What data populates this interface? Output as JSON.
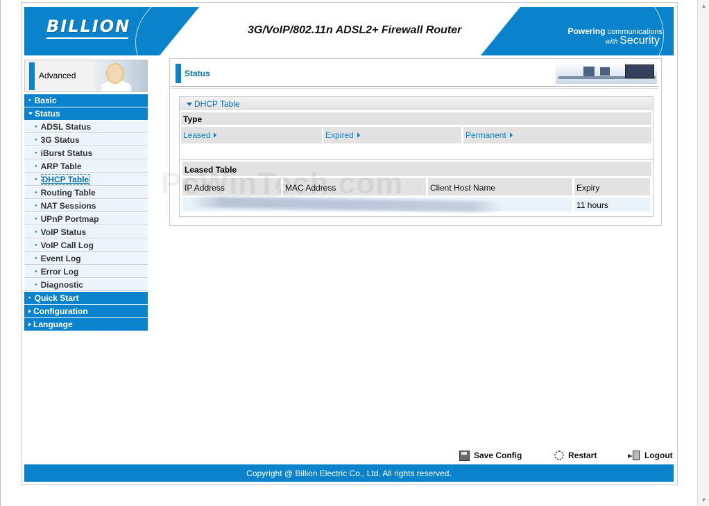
{
  "header": {
    "logo": "BILLION",
    "router_title": "3G/VoIP/802.11n ADSL2+ Firewall Router",
    "tagline_powering": "Powering",
    "tagline_communications": "communications",
    "tagline_with": "with",
    "tagline_security": "Security"
  },
  "sidebar": {
    "mode_label": "Advanced",
    "items": [
      {
        "label": "Basic",
        "type": "main",
        "expanded": false
      },
      {
        "label": "Status",
        "type": "main",
        "expanded": true
      },
      {
        "label": "ADSL Status",
        "type": "sub"
      },
      {
        "label": "3G Status",
        "type": "sub"
      },
      {
        "label": "iBurst Status",
        "type": "sub"
      },
      {
        "label": "ARP Table",
        "type": "sub"
      },
      {
        "label": "DHCP Table",
        "type": "sub",
        "active": true
      },
      {
        "label": "Routing Table",
        "type": "sub"
      },
      {
        "label": "NAT Sessions",
        "type": "sub"
      },
      {
        "label": "UPnP Portmap",
        "type": "sub"
      },
      {
        "label": "VoIP Status",
        "type": "sub"
      },
      {
        "label": "VoIP Call Log",
        "type": "sub"
      },
      {
        "label": "Event Log",
        "type": "sub"
      },
      {
        "label": "Error Log",
        "type": "sub"
      },
      {
        "label": "Diagnostic",
        "type": "sub"
      },
      {
        "label": "Quick Start",
        "type": "main",
        "expanded": false
      },
      {
        "label": "Configuration",
        "type": "main",
        "expanded": false
      },
      {
        "label": "Language",
        "type": "main",
        "expanded": false
      }
    ]
  },
  "content": {
    "section_title": "Status",
    "dhcp": {
      "title": "DHCP Table",
      "type_label": "Type",
      "type_links": [
        "Leased",
        "Expired",
        "Permanent"
      ],
      "leased_table_title": "Leased Table",
      "columns": [
        "IP Address",
        "MAC Address",
        "Client Host Name",
        "Expiry"
      ],
      "rows": [
        {
          "expiry": "11 hours"
        }
      ]
    }
  },
  "watermark": "PcWinTech.com",
  "actions": {
    "save": "Save Config",
    "restart": "Restart",
    "logout": "Logout"
  },
  "footer": {
    "copyright": "Copyright @ Billion Electric Co., Ltd. All rights reserved."
  },
  "colors": {
    "brand_blue": "#0a83cc",
    "link_blue": "#0a6db5",
    "cell_gray": "#e2e2e2"
  }
}
